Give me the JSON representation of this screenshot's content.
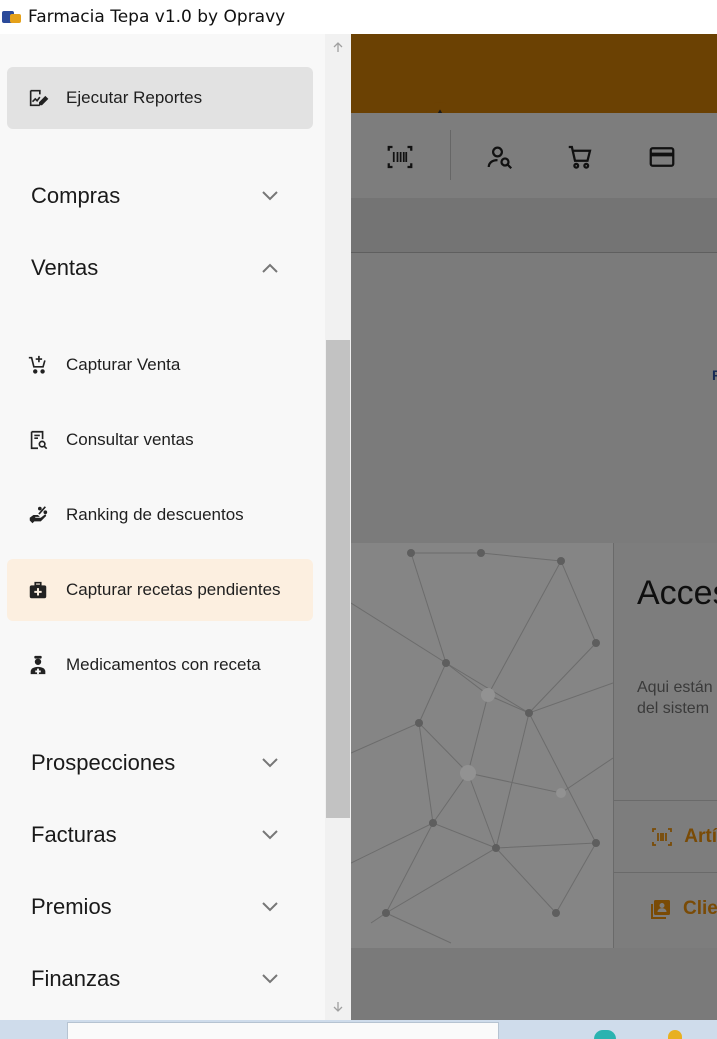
{
  "window": {
    "title": "Farmacia Tepa v1.0 by Opravy"
  },
  "drawer": {
    "top_item": {
      "label": "Ejecutar Reportes",
      "icon": "report-edit-icon"
    },
    "sections": [
      {
        "label": "Compras",
        "expanded": false
      },
      {
        "label": "Ventas",
        "expanded": true
      },
      {
        "label": "Prospecciones",
        "expanded": false
      },
      {
        "label": "Facturas",
        "expanded": false
      },
      {
        "label": "Premios",
        "expanded": false
      },
      {
        "label": "Finanzas",
        "expanded": false
      }
    ],
    "ventas_items": [
      {
        "label": "Capturar Venta",
        "icon": "cart-add-icon"
      },
      {
        "label": "Consultar ventas",
        "icon": "receipt-search-icon"
      },
      {
        "label": "Ranking de descuentos",
        "icon": "discount-hand-icon"
      },
      {
        "label": "Capturar recetas pendientes",
        "icon": "medical-bag-icon",
        "highlighted": true
      },
      {
        "label": "Medicamentos con receta",
        "icon": "doctor-icon"
      }
    ]
  },
  "background_app": {
    "card_title": "Acces",
    "card_description_line1": "Aqui están",
    "card_description_line2": "del sistem",
    "card_rows": [
      {
        "label": "Artí",
        "icon": "barcode-icon"
      },
      {
        "label": "Clie",
        "icon": "contacts-icon"
      }
    ],
    "accent_letter": "F",
    "toolbar_icons": [
      "barcode-scan-icon",
      "user-search-icon",
      "cart-icon",
      "credit-card-icon"
    ]
  },
  "colors": {
    "header_brown": "#6b4103",
    "accent_orange": "#7a4b06",
    "highlight_bg": "#fcefe0",
    "active_bg": "#e2e2e2"
  }
}
